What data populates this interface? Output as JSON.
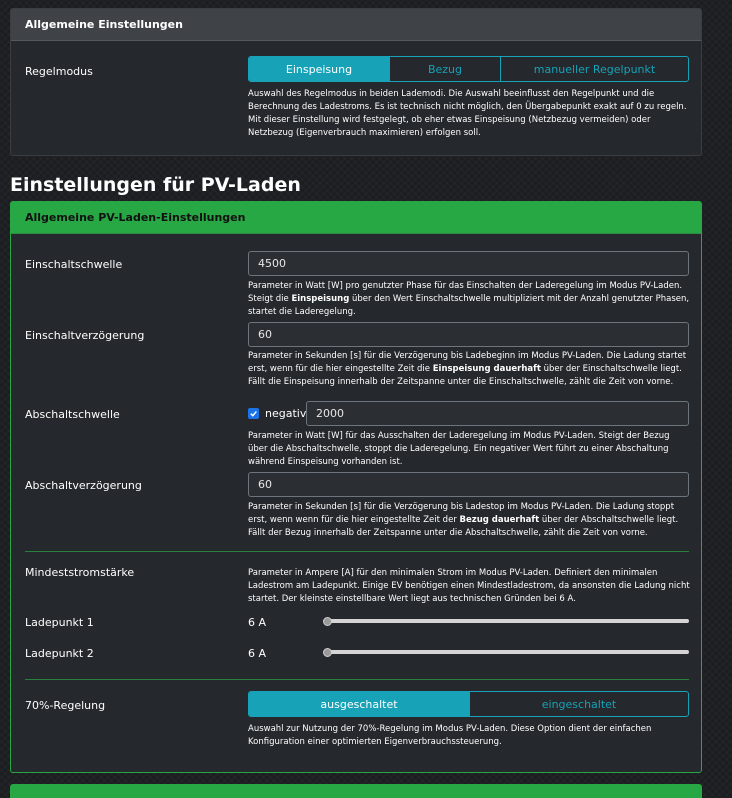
{
  "general": {
    "header": "Allgemeine Einstellungen",
    "control_mode_label": "Regelmodus",
    "control_mode_options": [
      "Einspeisung",
      "Bezug",
      "manueller Regelpunkt"
    ],
    "control_mode_selected": "Einspeisung",
    "control_mode_help": "Auswahl des Regelmodus in beiden Lademodi. Die Auswahl beeinflusst den Regelpunkt und die Berechnung des Ladestroms. Es ist technisch nicht möglich, den Übergabepunkt exakt auf 0 zu regeln. Mit dieser Einstellung wird festgelegt, ob eher etwas Einspeisung (Netzbezug vermeiden) oder Netzbezug (Eigenverbrauch maximieren) erfolgen soll."
  },
  "pv": {
    "section_title": "Einstellungen für PV-Laden",
    "header": "Allgemeine PV-Laden-Einstellungen",
    "switch_on_threshold": {
      "label": "Einschaltschwelle",
      "value": "4500",
      "help_1": "Parameter in Watt [W] pro genutzter Phase für das Einschalten der Laderegelung im Modus PV-Laden. Steigt die ",
      "help_bold": "Einspeisung",
      "help_2": " über den Wert Einschaltschwelle multipliziert mit der Anzahl genutzter Phasen, startet die Laderegelung."
    },
    "switch_on_delay": {
      "label": "Einschaltverzögerung",
      "value": "60",
      "help_1": "Parameter in Sekunden [s] für die Verzögerung bis Ladebeginn im Modus PV-Laden. Die Ladung startet erst, wenn für die hier eingestellte Zeit die ",
      "help_bold": "Einspeisung dauerhaft",
      "help_2": " über der Einschaltschwelle liegt. Fällt die Einspeisung innerhalb der Zeitspanne unter die Einschaltschwelle, zählt die Zeit von vorne."
    },
    "switch_off_threshold": {
      "label": "Abschaltschwelle",
      "negative_label": "negativ",
      "negative_checked": true,
      "value": "2000",
      "help": "Parameter in Watt [W] für das Ausschalten der Laderegelung im Modus PV-Laden. Steigt der Bezug über die Abschaltschwelle, stoppt die Laderegelung. Ein negativer Wert führt zu einer Abschaltung während Einspeisung vorhanden ist."
    },
    "switch_off_delay": {
      "label": "Abschaltverzögerung",
      "value": "60",
      "help_1": "Parameter in Sekunden [s] für die Verzögerung bis Ladestop im Modus PV-Laden. Die Ladung stoppt erst, wenn wenn für die hier eingestellte Zeit der ",
      "help_bold": "Bezug dauerhaft",
      "help_2": " über der Abschaltschwelle liegt. Fällt der Bezug innerhalb der Zeitspanne unter die Abschaltschwelle, zählt die Zeit von vorne."
    },
    "min_current": {
      "label": "Mindeststromstärke",
      "help": "Parameter in Ampere [A] für den minimalen Strom im Modus PV-Laden. Definiert den minimalen Ladestrom am Ladepunkt. Einige EV benötigen einen Mindestladestrom, da ansonsten die Ladung nicht startet. Der kleinste einstellbare Wert liegt aus technischen Gründen bei 6 A.",
      "chargepoints": [
        {
          "label": "Ladepunkt 1",
          "value": "6 A",
          "level": 0
        },
        {
          "label": "Ladepunkt 2",
          "value": "6 A",
          "level": 0
        }
      ]
    },
    "seventy_percent": {
      "label": "70%-Regelung",
      "options": [
        "ausgeschaltet",
        "eingeschaltet"
      ],
      "selected": "ausgeschaltet",
      "help": "Auswahl zur Nutzung der 70%-Regelung im Modus PV-Laden. Diese Option dient der einfachen Konfiguration einer optimierten Eigenverbrauchssteuerung."
    }
  },
  "colors": {
    "accent": "#17a2b8",
    "green": "#28a745",
    "checkbox": "#1a73e8"
  }
}
